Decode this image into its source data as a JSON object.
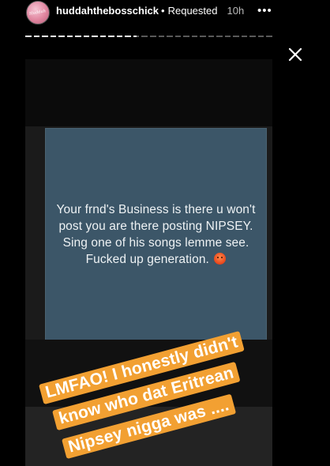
{
  "header": {
    "username": "huddahthebosschick",
    "separator": "•",
    "status": "Requested",
    "time": "10h",
    "more": "•••",
    "avatar_text": "Huddah"
  },
  "progress": {
    "segments": [
      1,
      1,
      1,
      1,
      1,
      1,
      1,
      1,
      1,
      1,
      1,
      1,
      1,
      1,
      1,
      1,
      1,
      1,
      1,
      1,
      1,
      1,
      1,
      1,
      1,
      1,
      1,
      1,
      1,
      1
    ],
    "current_index": 13,
    "current_fraction": 0.6
  },
  "story": {
    "screenshot_text": "Your frnd's Business is there u won't post you are there posting NIPSEY. Sing one of his songs lemme see. Fucked up generation.",
    "caption_lines": [
      "LMFAO! I honestly didn't",
      "know who dat Eritrean",
      "Nipsey nigga was ...."
    ]
  },
  "colors": {
    "caption_bg": "#f2a032",
    "card_bg": "#3c5668"
  },
  "icons": {
    "close": "close-icon",
    "more": "more-icon",
    "emoji": "angry-face-icon"
  }
}
